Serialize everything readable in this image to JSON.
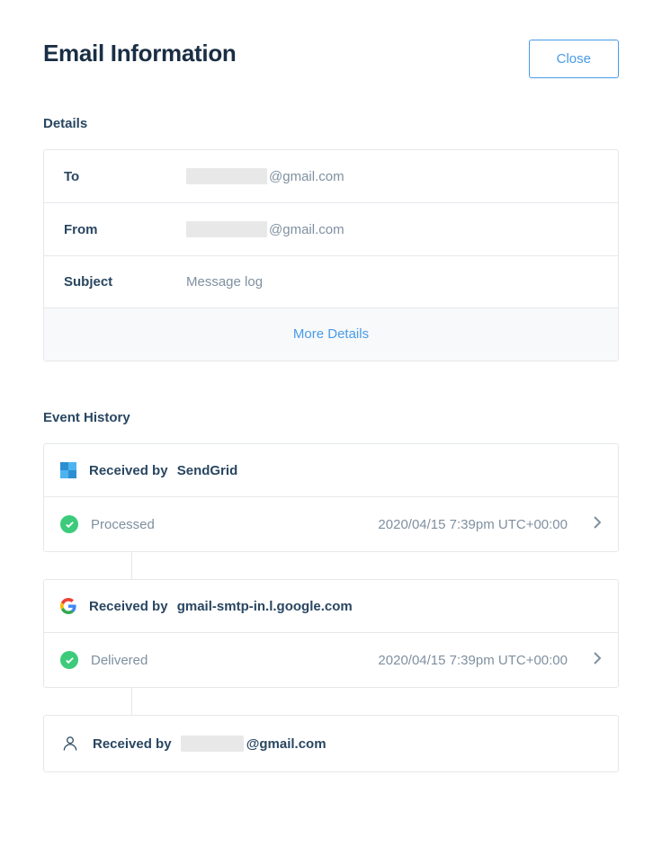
{
  "header": {
    "title": "Email Information",
    "close_label": "Close"
  },
  "details": {
    "section_title": "Details",
    "rows": [
      {
        "label": "To",
        "redacted_width": 90,
        "value_suffix": "@gmail.com"
      },
      {
        "label": "From",
        "redacted_width": 90,
        "value_suffix": "@gmail.com"
      },
      {
        "label": "Subject",
        "redacted_width": 0,
        "value_suffix": "Message log"
      }
    ],
    "more_label": "More Details"
  },
  "event_history": {
    "section_title": "Event History",
    "groups": [
      {
        "icon": "sendgrid",
        "received_by_prefix": "Received by",
        "received_by_value": "SendGrid",
        "redacted_width": 0,
        "events": [
          {
            "status": "Processed",
            "timestamp": "2020/04/15 7:39pm UTC+00:00"
          }
        ]
      },
      {
        "icon": "google",
        "received_by_prefix": "Received by",
        "received_by_value": "gmail-smtp-in.l.google.com",
        "redacted_width": 0,
        "events": [
          {
            "status": "Delivered",
            "timestamp": "2020/04/15 7:39pm UTC+00:00"
          }
        ]
      },
      {
        "icon": "person",
        "received_by_prefix": "Received by",
        "received_by_value": "@gmail.com",
        "redacted_width": 70,
        "events": []
      }
    ]
  }
}
